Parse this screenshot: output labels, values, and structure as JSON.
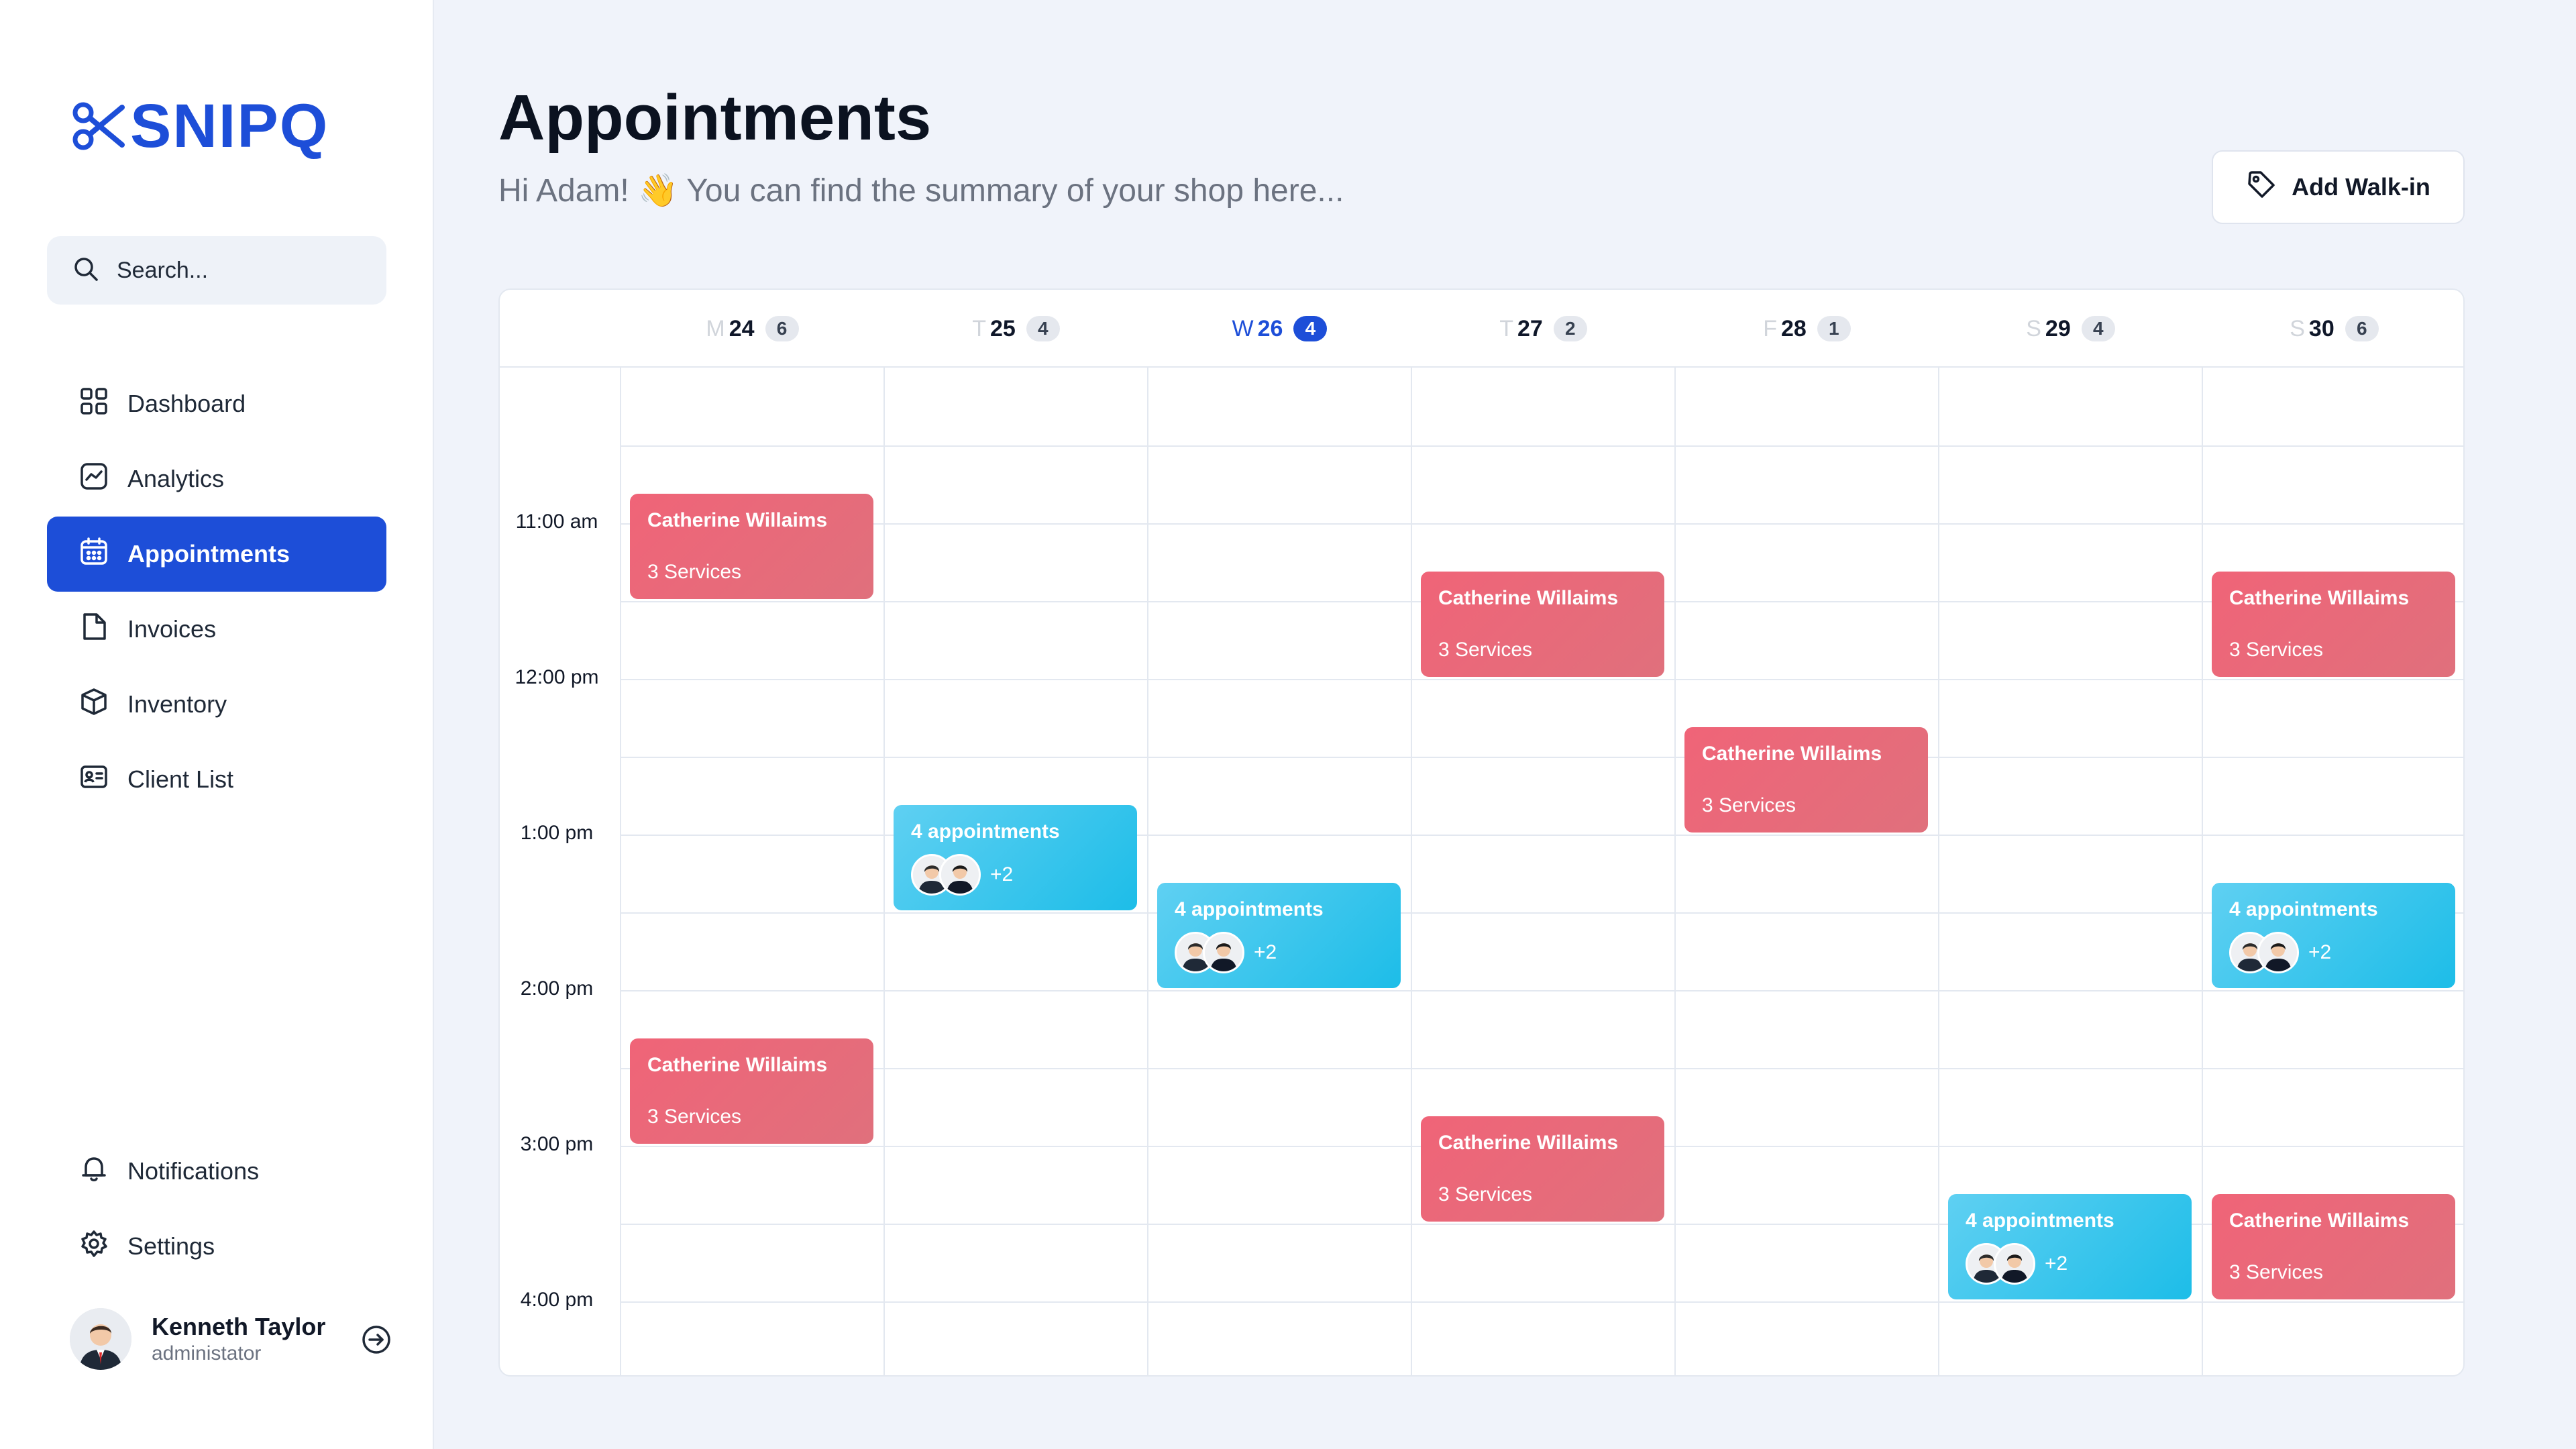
{
  "brand": {
    "name": "SNIPQ",
    "color": "#1d4ed8"
  },
  "search": {
    "placeholder": "Search..."
  },
  "nav": {
    "items": [
      {
        "label": "Dashboard",
        "icon": "grid-icon"
      },
      {
        "label": "Analytics",
        "icon": "chart-icon"
      },
      {
        "label": "Appointments",
        "icon": "calendar-icon",
        "active": true
      },
      {
        "label": "Invoices",
        "icon": "document-icon"
      },
      {
        "label": "Inventory",
        "icon": "box-icon"
      },
      {
        "label": "Client List",
        "icon": "id-card-icon"
      }
    ],
    "bottom": [
      {
        "label": "Notifications",
        "icon": "bell-icon"
      },
      {
        "label": "Settings",
        "icon": "gear-icon"
      }
    ]
  },
  "user": {
    "name": "Kenneth Taylor",
    "role": "administator"
  },
  "header": {
    "title": "Appointments",
    "subtitle": "Hi Adam! 👋 You can find the summary of your shop here...",
    "walkin_label": "Add Walk-in"
  },
  "calendar": {
    "days": [
      {
        "letter": "M",
        "date": "24",
        "count": "6",
        "today": false
      },
      {
        "letter": "T",
        "date": "25",
        "count": "4",
        "today": false
      },
      {
        "letter": "W",
        "date": "26",
        "count": "4",
        "today": true
      },
      {
        "letter": "T",
        "date": "27",
        "count": "2",
        "today": false
      },
      {
        "letter": "F",
        "date": "28",
        "count": "1",
        "today": false
      },
      {
        "letter": "S",
        "date": "29",
        "count": "4",
        "today": false
      },
      {
        "letter": "S",
        "date": "30",
        "count": "6",
        "today": false
      }
    ],
    "times": [
      "11:00 am",
      "12:00 pm",
      "1:00 pm",
      "2:00 pm",
      "3:00 pm",
      "4:00 pm"
    ],
    "events": [
      {
        "day": 0,
        "start": "10:45",
        "end": "11:35",
        "type": "single",
        "title": "Catherine Willaims",
        "detail": "3 Services"
      },
      {
        "day": 3,
        "start": "11:15",
        "end": "12:05",
        "type": "single",
        "title": "Catherine Willaims",
        "detail": "3 Services"
      },
      {
        "day": 6,
        "start": "11:15",
        "end": "12:05",
        "type": "single",
        "title": "Catherine Willaims",
        "detail": "3 Services"
      },
      {
        "day": 4,
        "start": "12:15",
        "end": "13:05",
        "type": "single",
        "title": "Catherine Willaims",
        "detail": "3 Services"
      },
      {
        "day": 1,
        "start": "12:45",
        "end": "13:35",
        "type": "group",
        "title": "4 appointments",
        "detail": "+2"
      },
      {
        "day": 2,
        "start": "13:15",
        "end": "14:05",
        "type": "group",
        "title": "4 appointments",
        "detail": "+2"
      },
      {
        "day": 6,
        "start": "13:15",
        "end": "14:05",
        "type": "group",
        "title": "4 appointments",
        "detail": "+2"
      },
      {
        "day": 0,
        "start": "14:15",
        "end": "15:05",
        "type": "single",
        "title": "Catherine Willaims",
        "detail": "3 Services"
      },
      {
        "day": 3,
        "start": "14:45",
        "end": "15:35",
        "type": "single",
        "title": "Catherine Willaims",
        "detail": "3 Services"
      },
      {
        "day": 5,
        "start": "15:15",
        "end": "16:05",
        "type": "group",
        "title": "4 appointments",
        "detail": "+2"
      },
      {
        "day": 6,
        "start": "15:15",
        "end": "16:05",
        "type": "single",
        "title": "Catherine Willaims",
        "detail": "3 Services"
      }
    ]
  },
  "colors": {
    "accent": "#1d4ed8",
    "appointment_single": "#f06478",
    "appointment_group": "#1dbde8"
  }
}
